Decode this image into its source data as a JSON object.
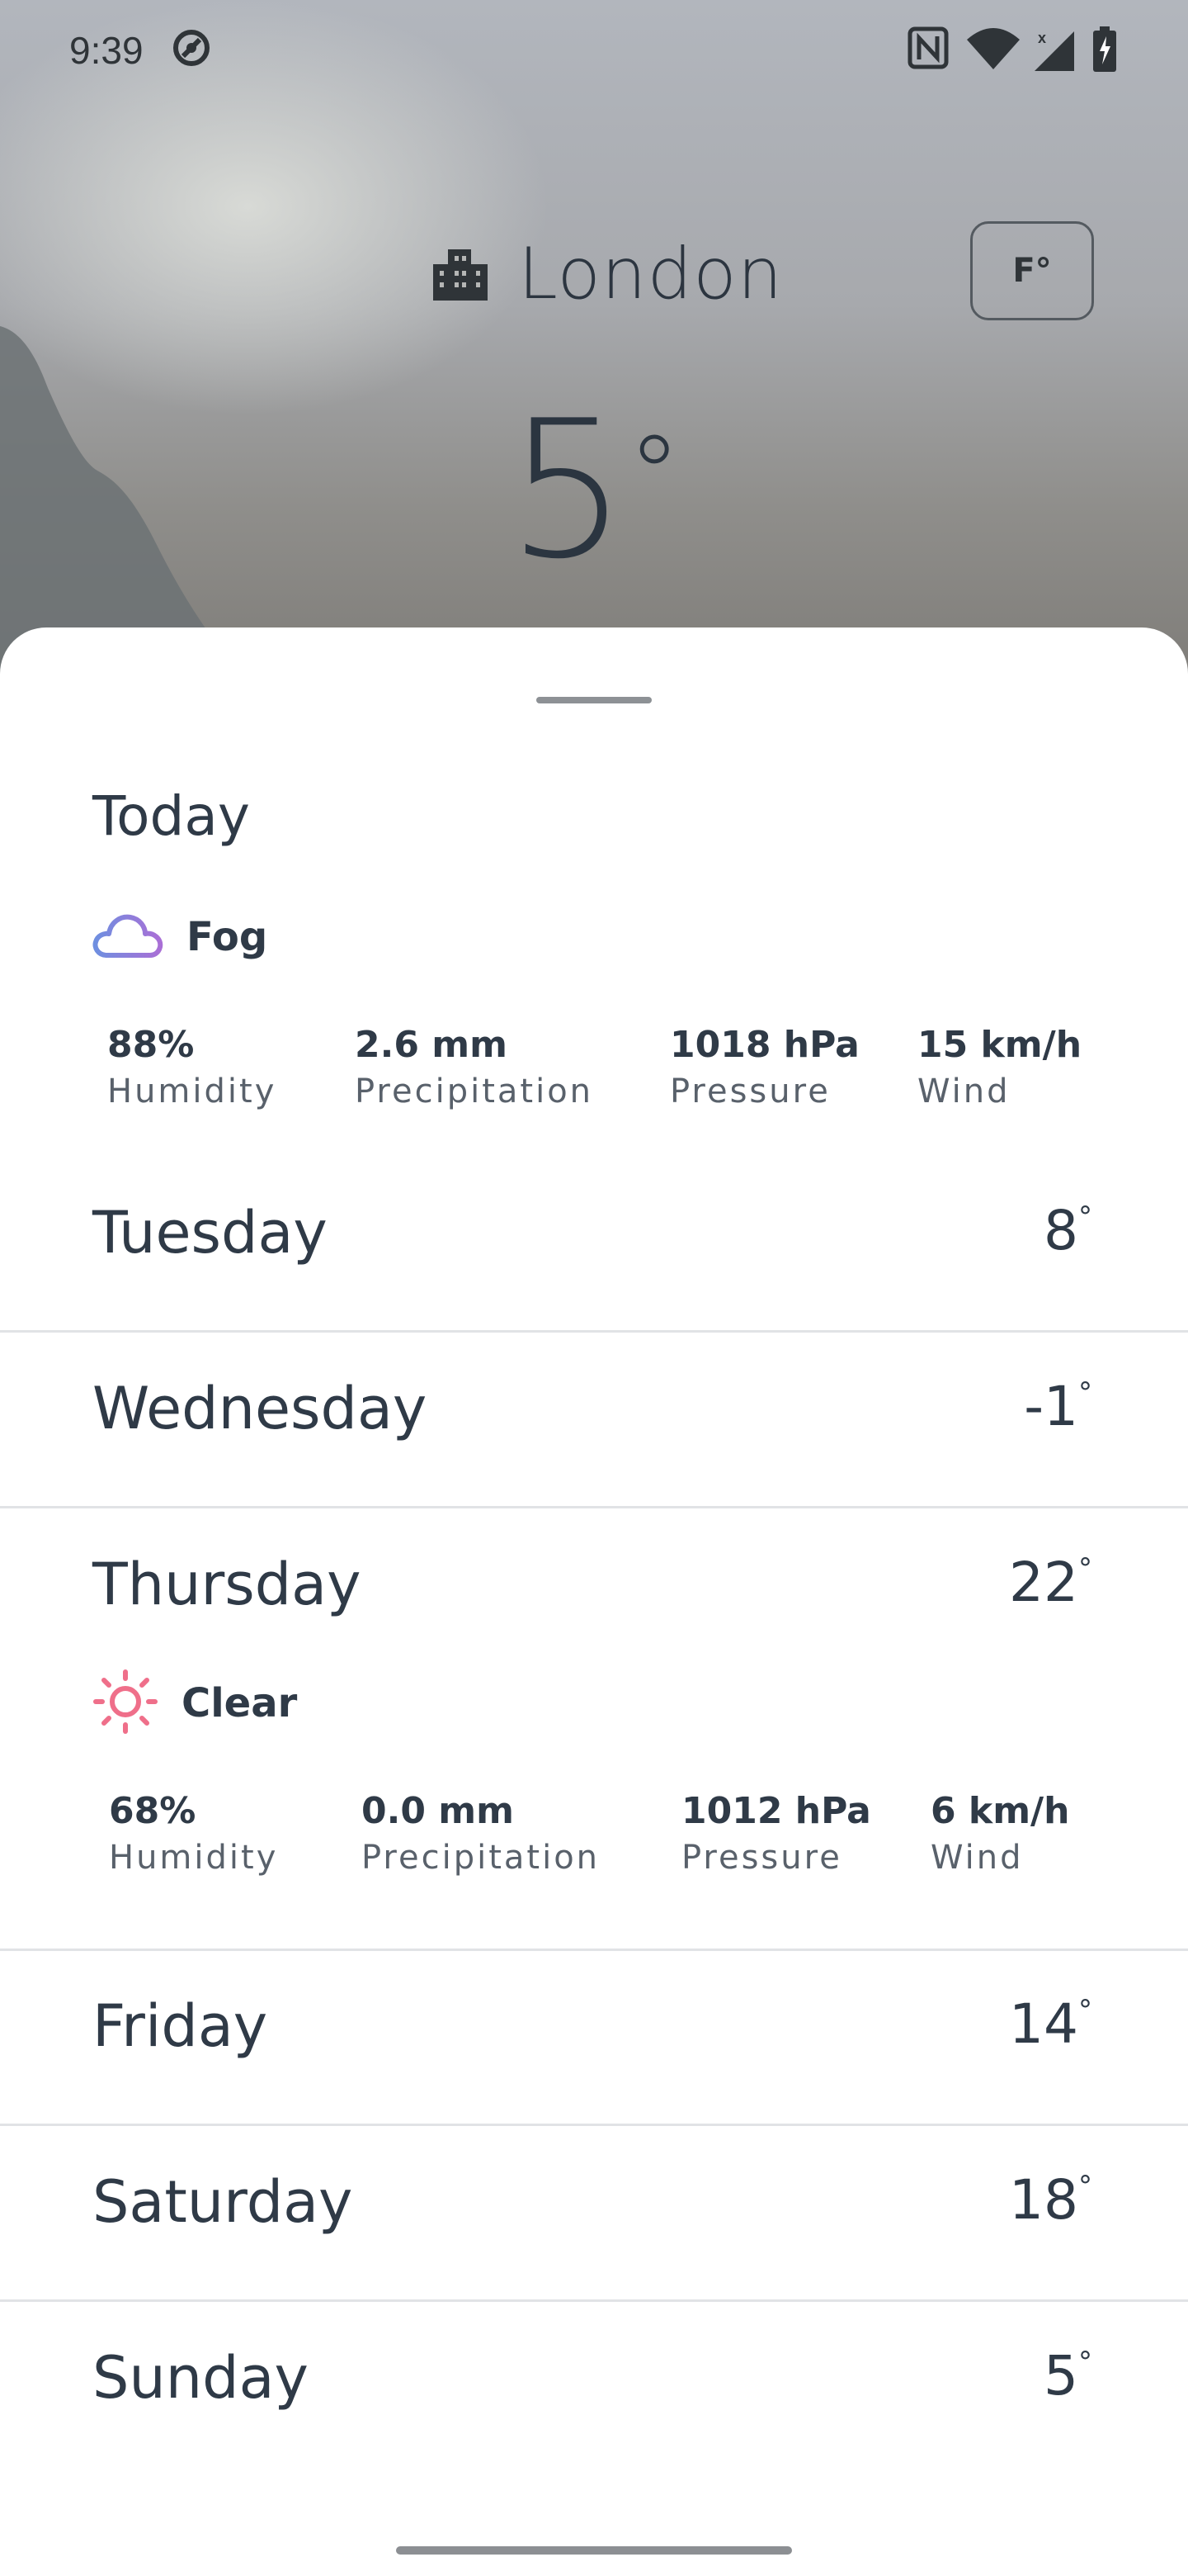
{
  "status_bar": {
    "time": "9:39",
    "icons": [
      "at-sign-icon",
      "nfc-icon",
      "wifi-icon",
      "signal-icon",
      "battery-charging-icon"
    ]
  },
  "header": {
    "city": "London",
    "city_icon": "city-buildings-icon",
    "unit_toggle": "F°",
    "current_temp": "5",
    "degree_symbol": "°"
  },
  "today": {
    "title": "Today",
    "condition": {
      "icon": "cloud-icon",
      "label": "Fog"
    },
    "stats": [
      {
        "value": "88%",
        "label": "Humidity"
      },
      {
        "value": "2.6 mm",
        "label": "Precipitation"
      },
      {
        "value": "1018 hPa",
        "label": "Pressure"
      },
      {
        "value": "15 km/h",
        "label": "Wind"
      }
    ]
  },
  "forecast": [
    {
      "day": "Tuesday",
      "temp": "8"
    },
    {
      "day": "Wednesday",
      "temp": "-1"
    },
    {
      "day": "Thursday",
      "temp": "22",
      "condition": {
        "icon": "sun-icon",
        "label": "Clear"
      },
      "stats": [
        {
          "value": "68%",
          "label": "Humidity"
        },
        {
          "value": "0.0 mm",
          "label": "Precipitation"
        },
        {
          "value": "1012 hPa",
          "label": "Pressure"
        },
        {
          "value": "6 km/h",
          "label": "Wind"
        }
      ]
    },
    {
      "day": "Friday",
      "temp": "14"
    },
    {
      "day": "Saturday",
      "temp": "18"
    },
    {
      "day": "Sunday",
      "temp": "5"
    }
  ],
  "degree_symbol": "°",
  "colors": {
    "text": "#2f3a47",
    "cloud_gradient": [
      "#6f8fe0",
      "#a96fd6"
    ],
    "sun": "#ef6f8a",
    "divider": "#e1e3e6"
  }
}
